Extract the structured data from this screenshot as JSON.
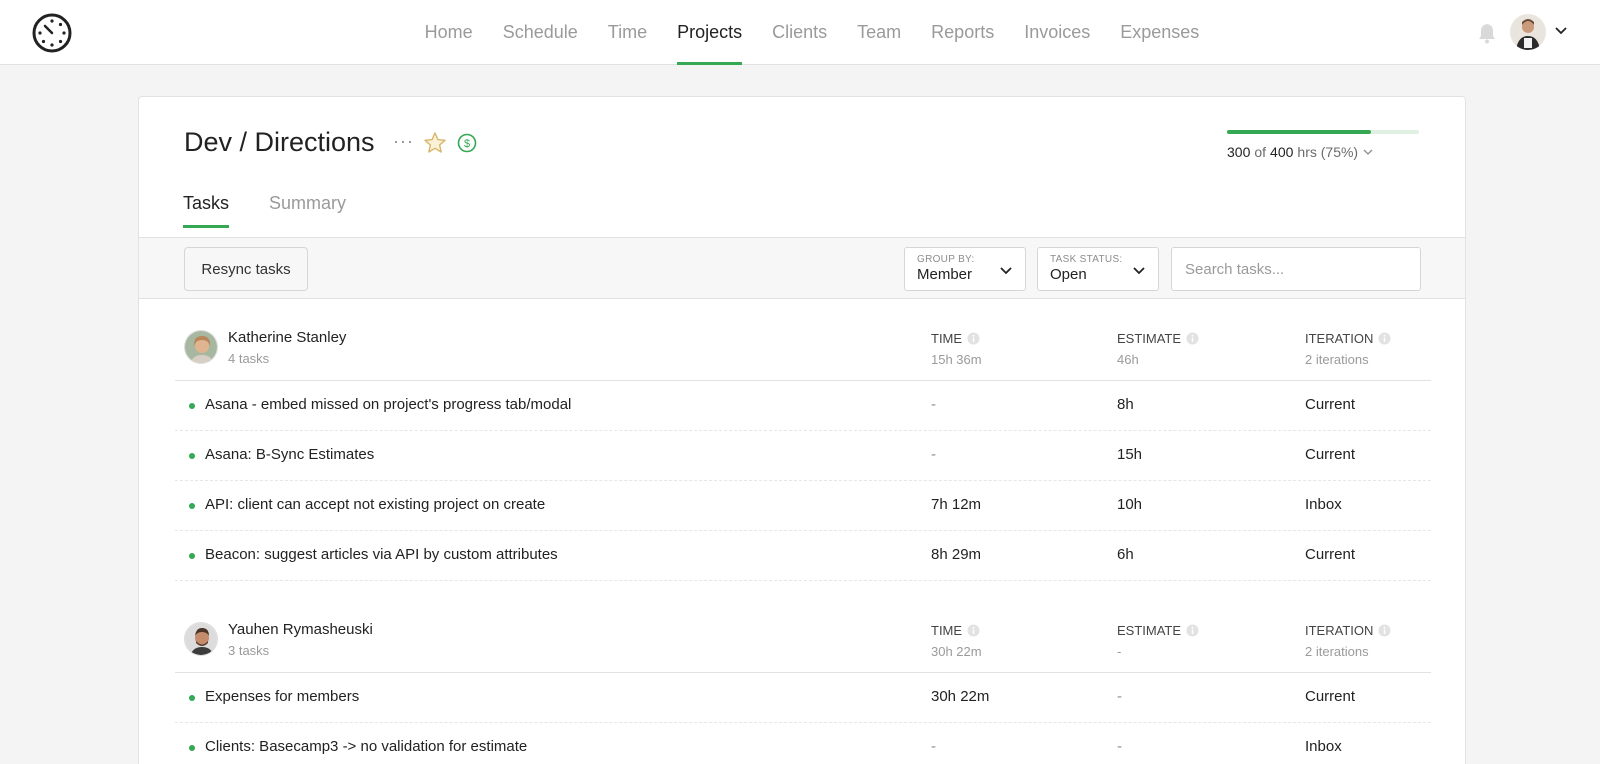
{
  "nav": {
    "items": [
      {
        "label": "Home",
        "active": false
      },
      {
        "label": "Schedule",
        "active": false
      },
      {
        "label": "Time",
        "active": false
      },
      {
        "label": "Projects",
        "active": true
      },
      {
        "label": "Clients",
        "active": false
      },
      {
        "label": "Team",
        "active": false
      },
      {
        "label": "Reports",
        "active": false
      },
      {
        "label": "Invoices",
        "active": false
      },
      {
        "label": "Expenses",
        "active": false
      }
    ]
  },
  "colors": {
    "accent": "#34a853"
  },
  "project": {
    "title": "Dev / Directions",
    "more_icon": "more-icon",
    "favorite_icon": "star-icon",
    "billable_icon": "dollar-circle-icon",
    "progress": {
      "fraction": 0.75,
      "used": "300",
      "of_label": "of",
      "budget": "400",
      "suffix": "hrs (75%)"
    }
  },
  "tabs": [
    {
      "label": "Tasks",
      "active": true
    },
    {
      "label": "Summary",
      "active": false
    }
  ],
  "toolbar": {
    "resync_label": "Resync tasks",
    "group_by": {
      "caption": "GROUP BY:",
      "value": "Member"
    },
    "task_status": {
      "caption": "TASK STATUS:",
      "value": "Open"
    },
    "search_placeholder": "Search tasks..."
  },
  "columns": {
    "time": "TIME",
    "estimate": "ESTIMATE",
    "iteration": "ITERATION"
  },
  "groups": [
    {
      "member": "Katherine Stanley",
      "count": "4 tasks",
      "time_total": "15h 36m",
      "estimate_total": "46h",
      "iteration_total": "2 iterations",
      "tasks": [
        {
          "name": "Asana - embed missed on project's progress tab/modal",
          "time": "-",
          "estimate": "8h",
          "iteration": "Current"
        },
        {
          "name": "Asana: B-Sync Estimates",
          "time": "-",
          "estimate": "15h",
          "iteration": "Current"
        },
        {
          "name": "API: client can accept not existing project on create",
          "time": "7h 12m",
          "estimate": "10h",
          "iteration": "Inbox"
        },
        {
          "name": "Beacon: suggest articles via API by custom attributes",
          "time": "8h 29m",
          "estimate": "6h",
          "iteration": "Current"
        }
      ]
    },
    {
      "member": "Yauhen Rymasheuski",
      "count": "3 tasks",
      "time_total": "30h 22m",
      "estimate_total": "-",
      "iteration_total": "2 iterations",
      "tasks": [
        {
          "name": "Expenses for members",
          "time": "30h 22m",
          "estimate": "-",
          "iteration": "Current"
        },
        {
          "name": "Clients: Basecamp3 -> no validation for estimate",
          "time": "-",
          "estimate": "-",
          "iteration": "Inbox"
        }
      ]
    }
  ]
}
